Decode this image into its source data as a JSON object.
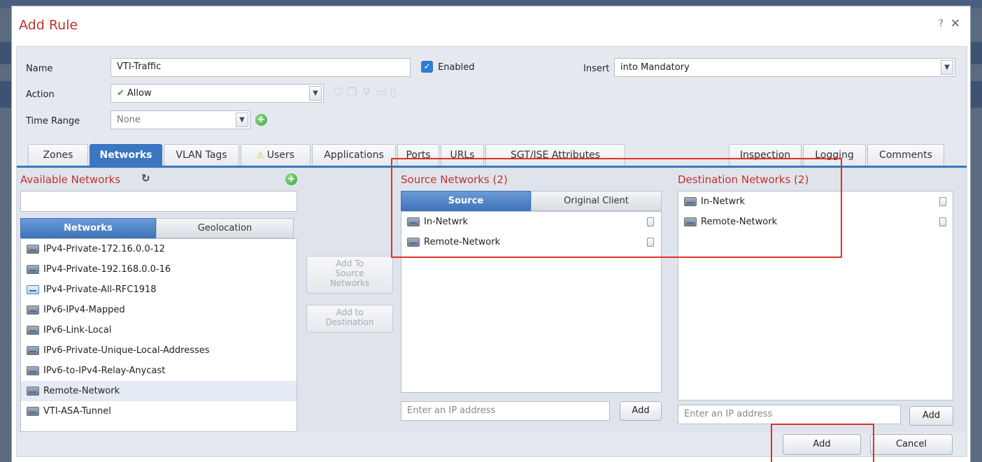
{
  "dialog": {
    "title": "Add Rule",
    "help": "?",
    "close": "✕"
  },
  "form": {
    "name_label": "Name",
    "name_value": "VTI-Traffic",
    "enabled_label": "Enabled",
    "enabled": true,
    "insert_label": "Insert",
    "insert_value": "into Mandatory",
    "action_label": "Action",
    "action_value": "Allow",
    "time_range_label": "Time Range",
    "time_range_value": "None"
  },
  "tabs": {
    "zones": "Zones",
    "networks": "Networks",
    "vlan_tags": "VLAN Tags",
    "users": "Users",
    "applications": "Applications",
    "ports": "Ports",
    "urls": "URLs",
    "sgt": "SGT/ISE Attributes",
    "inspection": "Inspection",
    "logging": "Logging",
    "comments": "Comments"
  },
  "available": {
    "title": "Available Networks",
    "search_value": "",
    "subtabs": {
      "networks": "Networks",
      "geolocation": "Geolocation"
    },
    "items": [
      {
        "label": "IPv4-Private-172.16.0.0-12"
      },
      {
        "label": "IPv4-Private-192.168.0.0-16"
      },
      {
        "label": "IPv4-Private-All-RFC1918"
      },
      {
        "label": "IPv6-IPv4-Mapped"
      },
      {
        "label": "IPv6-Link-Local"
      },
      {
        "label": "IPv6-Private-Unique-Local-Addresses"
      },
      {
        "label": "IPv6-to-IPv4-Relay-Anycast"
      },
      {
        "label": "Remote-Network"
      },
      {
        "label": "VTI-ASA-Tunnel"
      }
    ]
  },
  "middle": {
    "add_to_source": [
      "Add To",
      "Source",
      "Networks"
    ],
    "add_to_destination": [
      "Add to",
      "Destination"
    ]
  },
  "source": {
    "title": "Source Networks (2)",
    "subtabs": {
      "source": "Source",
      "original_client": "Original Client"
    },
    "items": [
      {
        "label": "In-Netwrk"
      },
      {
        "label": "Remote-Network"
      }
    ],
    "ip_placeholder": "Enter an IP address",
    "add_label": "Add"
  },
  "destination": {
    "title": "Destination Networks (2)",
    "items": [
      {
        "label": "In-Netwrk"
      },
      {
        "label": "Remote-Network"
      }
    ],
    "ip_placeholder": "Enter an IP address",
    "add_label": "Add"
  },
  "footer": {
    "add_label": "Add",
    "cancel_label": "Cancel"
  },
  "colors": {
    "accent": "#3b77c0",
    "title_red": "#c62f2f",
    "highlight": "#e0302a"
  }
}
